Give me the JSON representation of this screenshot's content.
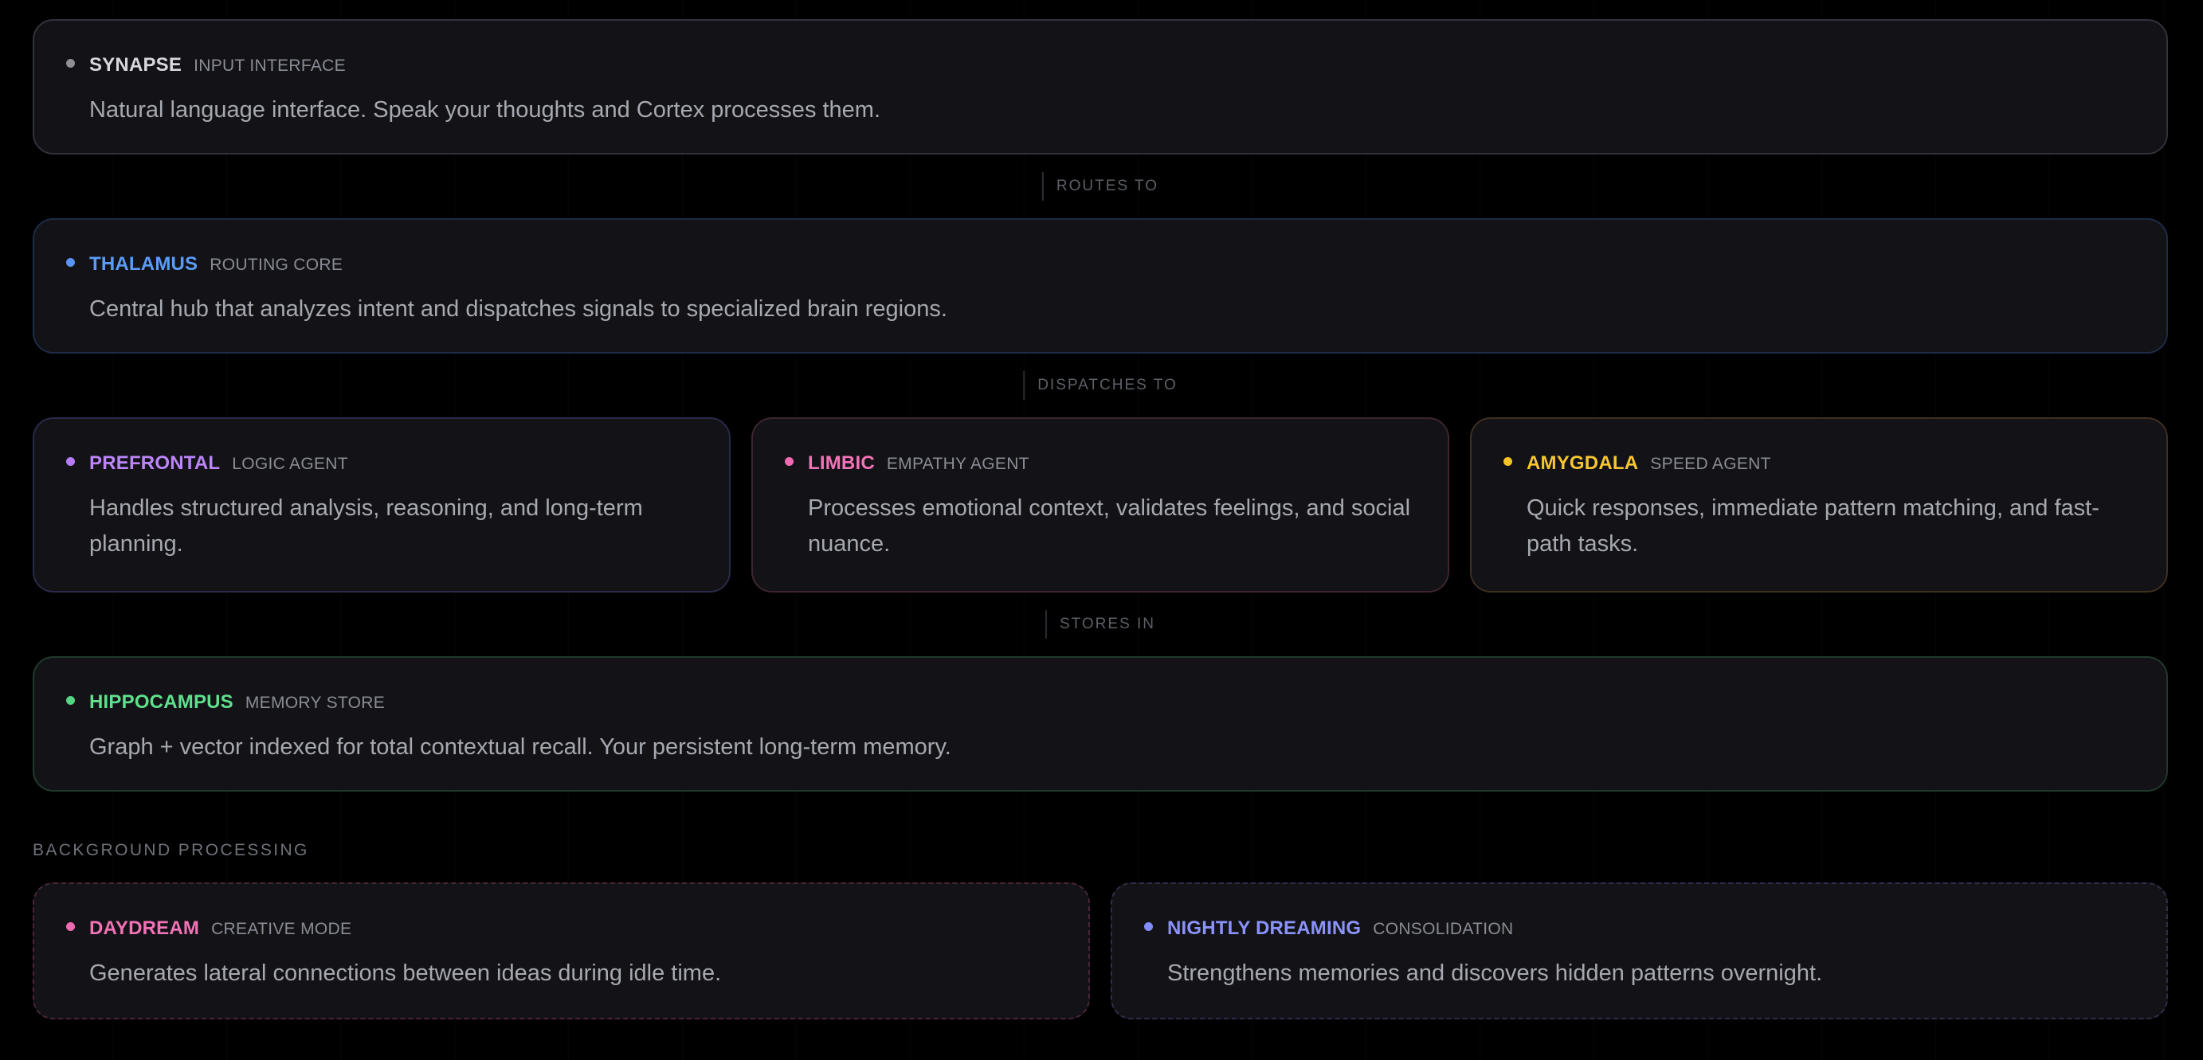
{
  "nodes": {
    "synapse": {
      "name": "SYNAPSE",
      "role": "INPUT INTERFACE",
      "description": "Natural language interface. Speak your thoughts and Cortex processes them.",
      "color": "#8e9096"
    },
    "thalamus": {
      "name": "THALAMUS",
      "role": "ROUTING CORE",
      "description": "Central hub that analyzes intent and dispatches signals to specialized brain regions.",
      "color": "#5b9cf8"
    },
    "prefrontal": {
      "name": "PREFRONTAL",
      "role": "LOGIC AGENT",
      "description": "Handles structured analysis, reasoning, and long-term planning.",
      "color": "#bd85fb"
    },
    "limbic": {
      "name": "LIMBIC",
      "role": "EMPATHY AGENT",
      "description": "Processes emotional context, validates feelings, and social nuance.",
      "color": "#f472b6"
    },
    "amygdala": {
      "name": "AMYGDALA",
      "role": "SPEED AGENT",
      "description": "Quick responses, immediate pattern matching, and fast-path tasks.",
      "color": "#f8c630"
    },
    "hippocampus": {
      "name": "HIPPOCAMPUS",
      "role": "MEMORY STORE",
      "description": "Graph + vector indexed for total contextual recall. Your persistent long-term memory.",
      "color": "#5fe08b"
    },
    "daydream": {
      "name": "DAYDREAM",
      "role": "CREATIVE MODE",
      "description": "Generates lateral connections between ideas during idle time.",
      "color": "#f472b6"
    },
    "nightly": {
      "name": "NIGHTLY DREAMING",
      "role": "CONSOLIDATION",
      "description": "Strengthens memories and discovers hidden patterns overnight.",
      "color": "#8b93fb"
    }
  },
  "connectors": {
    "routes_to": "ROUTES TO",
    "dispatches_to": "DISPATCHES TO",
    "stores_in": "STORES IN"
  },
  "background_section": {
    "label": "BACKGROUND PROCESSING"
  }
}
